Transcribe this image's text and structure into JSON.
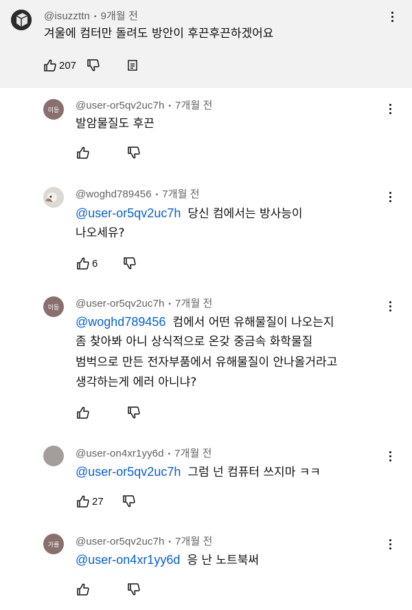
{
  "comments": [
    {
      "author": "@isuzzttn",
      "time": "9개월 전",
      "text": "겨울에 컴터만 돌려도 방안이 후끈후끈하겠어요",
      "likes": "207"
    },
    {
      "author": "@user-or5qv2uc7h",
      "time": "7개월 전",
      "avatar_text": "미등",
      "text": "발암물질도 후끈",
      "likes": ""
    },
    {
      "author": "@woghd789456",
      "time": "7개월 전",
      "mention": "@user-or5qv2uc7h",
      "text1": "당신 컴에서는 방사능이",
      "text2": "나오세유?",
      "likes": "6"
    },
    {
      "author": "@user-or5qv2uc7h",
      "time": "7개월 전",
      "avatar_text": "미등",
      "mention": "@woghd789456",
      "text1": "컴에서 어떤 유해물질이 나오는지",
      "text2": "좀 찾아봐 아니 상식적으로 온갖 중금속 화학물질",
      "text3": "범벅으로 만든 전자부품에서 유해물질이 안나올거라고",
      "text4": "생각하는게 에러 아니냐?",
      "likes": ""
    },
    {
      "author": "@user-on4xr1yy6d",
      "time": "7개월 전",
      "mention": "@user-or5qv2uc7h",
      "text": "그럼 넌 컴퓨터 쓰지마 ㅋㅋ",
      "likes": "27"
    },
    {
      "author": "@user-or5qv2uc7h",
      "time": "7개월 전",
      "avatar_text": "가를",
      "mention": "@user-on4xr1yy6d",
      "text": "응 난 노트북써",
      "likes": ""
    }
  ],
  "colors": {
    "top_bg": "#f2f2f2",
    "mention": "#065fd4",
    "meta": "#606060"
  },
  "icons": [
    "like-icon",
    "dislike-icon",
    "reply-icon",
    "more-options-icon"
  ]
}
